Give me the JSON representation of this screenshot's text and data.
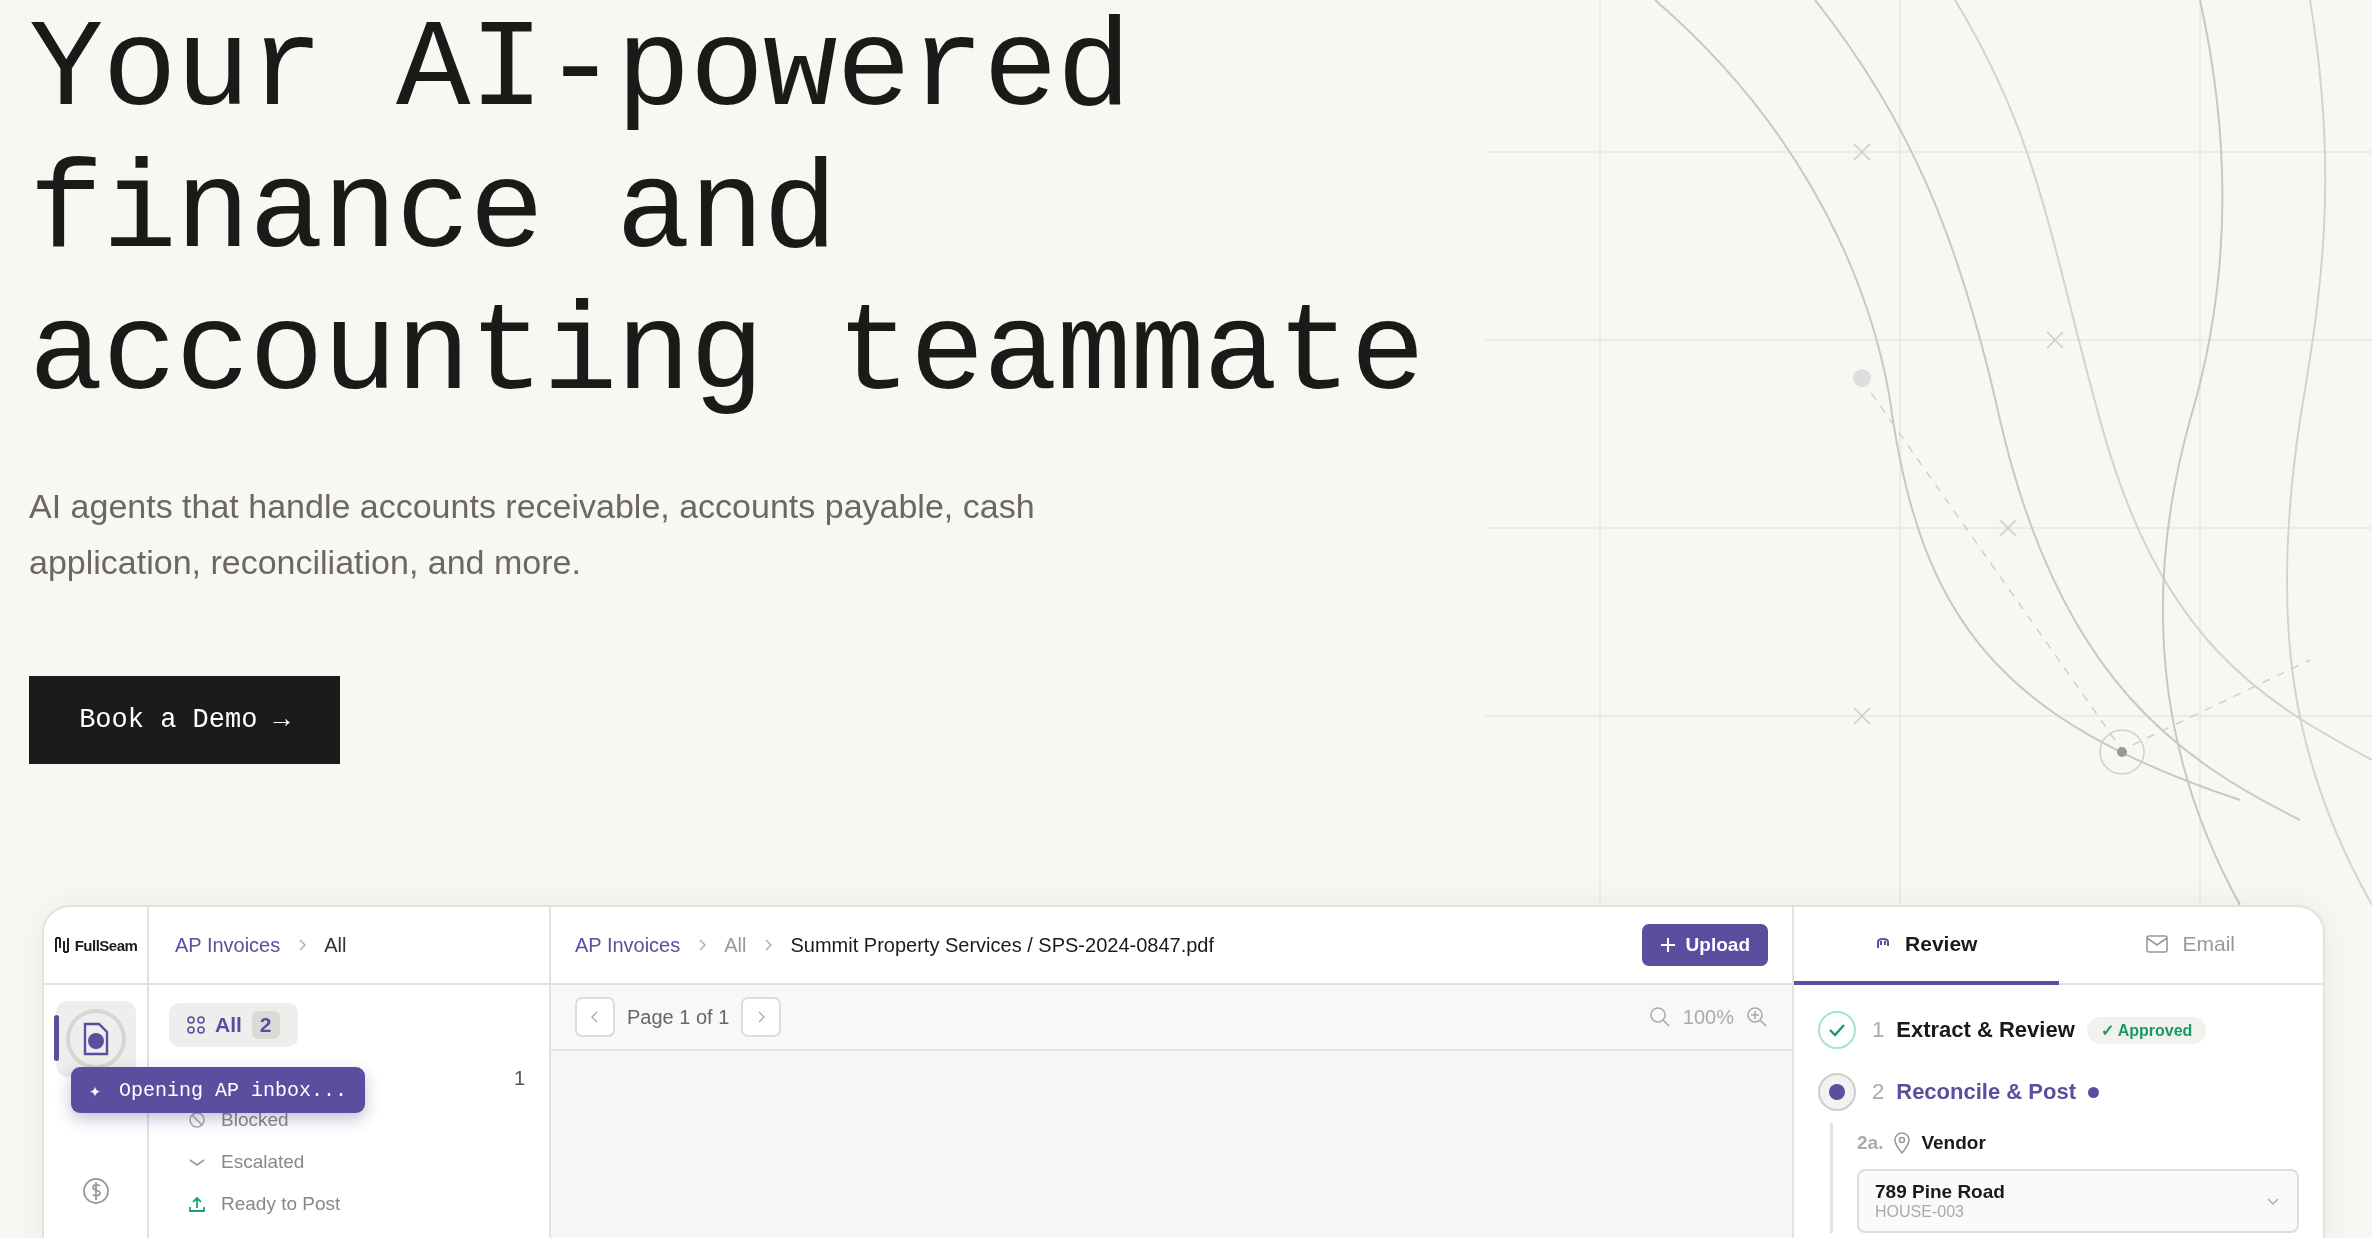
{
  "hero": {
    "title_lines": [
      "Your AI-powered",
      "finance and",
      "accounting teammate"
    ],
    "subtitle": "AI agents that handle accounts receivable, accounts payable, cash application, reconciliation, and more.",
    "cta": "Book a Demo →"
  },
  "app": {
    "logo": "FullSeam",
    "nav": [
      {
        "kind": "document",
        "selected": true
      },
      {
        "kind": "dollar",
        "selected": false
      }
    ],
    "tooltip": {
      "icon": "✦",
      "text": "Opening AP inbox..."
    },
    "list_pane": {
      "breadcrumb": [
        {
          "label": "AP Invoices",
          "link": true
        },
        {
          "label": "All",
          "link": false
        }
      ],
      "filter_chip": {
        "label": "All",
        "count": "2"
      },
      "filters": [
        {
          "kind": "plain",
          "count": "1"
        },
        {
          "kind": "blocked",
          "label": "Blocked"
        },
        {
          "kind": "escalated",
          "label": "Escalated"
        },
        {
          "kind": "upload",
          "label": "Ready to Post"
        }
      ]
    },
    "doc_pane": {
      "breadcrumb": [
        {
          "label": "AP Invoices",
          "link": true
        },
        {
          "label": "All",
          "link": false
        },
        {
          "label": "Summit Property Services / SPS-2024-0847.pdf",
          "link": false
        }
      ],
      "upload": "Upload",
      "pager": "Page 1 of 1",
      "zoom": "100%"
    },
    "review_pane": {
      "tabs": [
        {
          "label": "Review",
          "kind": "review",
          "selected": true
        },
        {
          "label": "Email",
          "kind": "mail",
          "selected": false
        }
      ],
      "steps": [
        {
          "number": "1",
          "title": "Extract & Review",
          "kind": "done",
          "badge": "✓ Approved"
        },
        {
          "number": "2",
          "title": "Reconcile & Post",
          "kind": "active"
        }
      ],
      "substep": {
        "number": "2a.",
        "label": "Vendor"
      },
      "vendor_field": {
        "value": "789 Pine Road",
        "code": "HOUSE-003"
      }
    }
  }
}
